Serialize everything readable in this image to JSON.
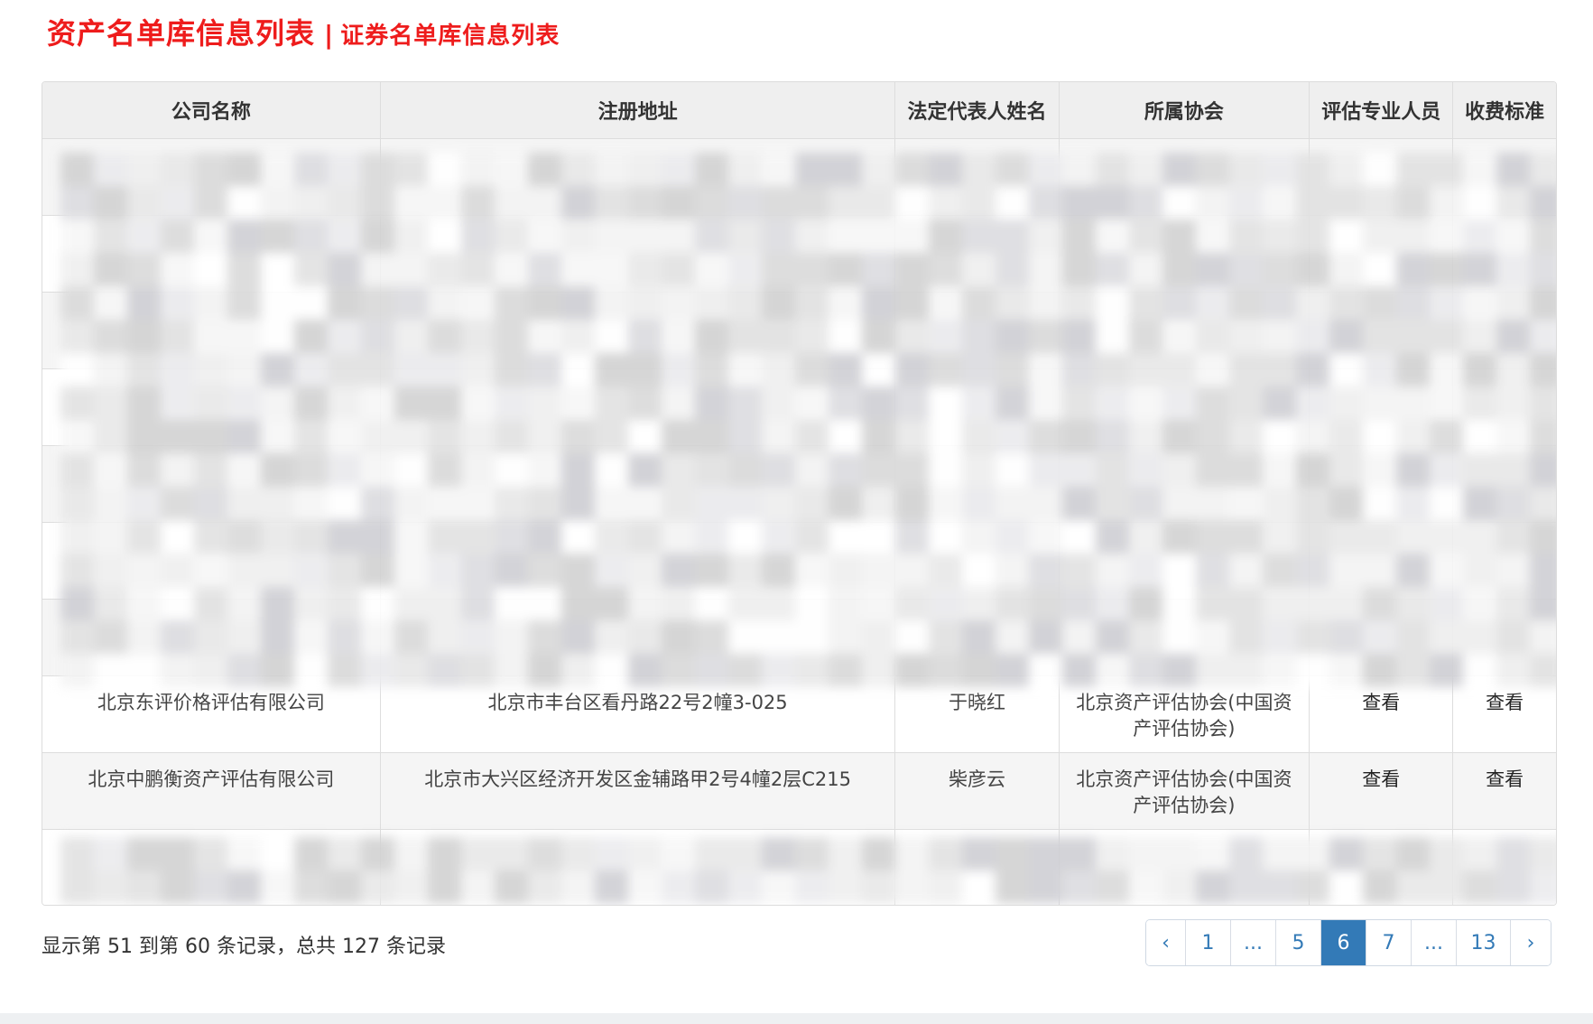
{
  "header": {
    "title_main": "资产名单库信息列表",
    "separator": "|",
    "title_sub": "证券名单库信息列表"
  },
  "table": {
    "columns": [
      "公司名称",
      "注册地址",
      "法定代表人姓名",
      "所属协会",
      "评估专业人员",
      "收费标准"
    ],
    "rows": [
      {
        "company": "北京东评价格评估有限公司",
        "address": "北京市丰台区看丹路22号2幢3-025",
        "rep": "于晓红",
        "association": "北京资产评估协会(中国资产评估协会)",
        "staff": "查看",
        "fee": "查看"
      },
      {
        "company": "北京中鹏衡资产评估有限公司",
        "address": "北京市大兴区经济开发区金辅路甲2号4幢2层C215",
        "rep": "柴彦云",
        "association": "北京资产评估协会(中国资产评估协会)",
        "staff": "查看",
        "fee": "查看"
      }
    ]
  },
  "footer": {
    "record_info": "显示第 51 到第 60 条记录，总共 127 条记录"
  },
  "pagination": {
    "prev": "‹",
    "pages": [
      "1",
      "...",
      "5",
      "6",
      "7",
      "...",
      "13"
    ],
    "current": "6",
    "next": "›"
  },
  "colors": {
    "title_red": "#ee1c1c",
    "pager_active": "#337ab7",
    "link_blue": "#337ab7"
  }
}
